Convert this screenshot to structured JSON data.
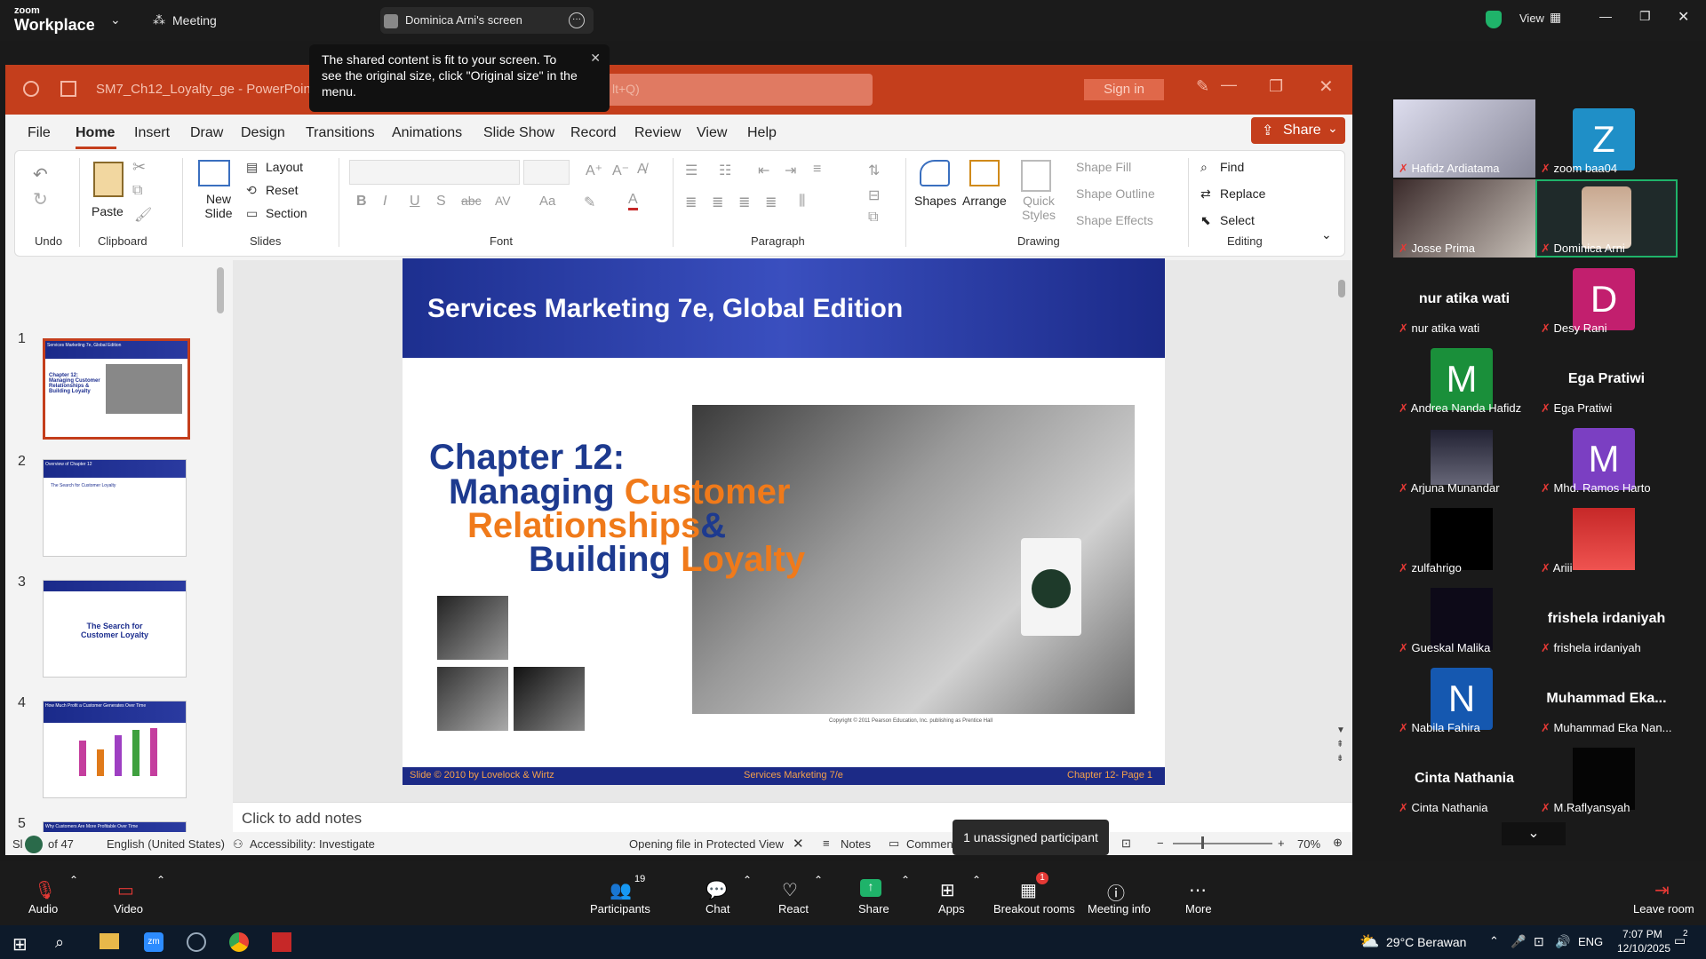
{
  "zoom": {
    "logo_top": "zoom",
    "logo_bottom": "Workplace",
    "meeting_label": "Meeting",
    "screen_tab": "Dominica Arni's screen",
    "view_label": "View",
    "tooltip": "The shared content is fit to your screen. To see the original size, click \"Original size\" in the menu.",
    "unassigned": "1 unassigned participant",
    "controls": {
      "audio": "Audio",
      "video": "Video",
      "participants": "Participants",
      "participants_count": "19",
      "chat": "Chat",
      "react": "React",
      "share": "Share",
      "apps": "Apps",
      "breakout": "Breakout rooms",
      "breakout_badge": "1",
      "info": "Meeting info",
      "more": "More",
      "leave": "Leave room"
    }
  },
  "ppt": {
    "title": "SM7_Ch12_Loyalty_ge - PowerPoint",
    "search_hint": "lt+Q)",
    "signin": "Sign in",
    "share": "Share",
    "menu": [
      "File",
      "Home",
      "Insert",
      "Draw",
      "Design",
      "Transitions",
      "Animations",
      "Slide Show",
      "Record",
      "Review",
      "View",
      "Help"
    ],
    "ribbon": {
      "undo": "Undo",
      "paste": "Paste",
      "clipboard": "Clipboard",
      "new_slide": "New Slide",
      "layout": "Layout",
      "reset": "Reset",
      "section": "Section",
      "slides": "Slides",
      "font": "Font",
      "paragraph": "Paragraph",
      "shapes": "Shapes",
      "arrange": "Arrange",
      "quick_styles": "Quick Styles",
      "shape_fill": "Shape Fill",
      "shape_outline": "Shape Outline",
      "shape_effects": "Shape Effects",
      "drawing": "Drawing",
      "find": "Find",
      "replace": "Replace",
      "select": "Select",
      "editing": "Editing"
    },
    "thumbnails": [
      {
        "num": "1",
        "title": "Services Marketing 7e, Global Edition",
        "body": "Chapter 12: Managing Customer Relationships & Building Loyalty"
      },
      {
        "num": "2",
        "title": "Overview of Chapter 12",
        "body": "The Search for Customer Loyalty"
      },
      {
        "num": "3",
        "title": "",
        "body": "The Search for Customer Loyalty"
      },
      {
        "num": "4",
        "title": "How Much Profit a Customer Generates Over Time",
        "body": ""
      },
      {
        "num": "5",
        "title": "Why Customers Are More Profitable Over Time",
        "body": ""
      }
    ],
    "slide": {
      "header": "Services Marketing 7e, Global Edition",
      "chapter": "Chapter 12:",
      "line2a": "Managing ",
      "line2b": "Customer",
      "line3a": "Relationships",
      "line3b": "&",
      "line4a": "Building ",
      "line4b": "Loyalty",
      "copyright": "Copyright © 2011 Pearson Education, Inc. publishing as Prentice Hall",
      "footer_left": "Slide © 2010 by Lovelock & Wirtz",
      "footer_center": "Services Marketing 7/e",
      "footer_right": "Chapter 12- Page 1"
    },
    "notes": "Click to add notes",
    "status": {
      "slide_of": "Sl",
      "slide_of2": "of 47",
      "language": "English (United States)",
      "accessibility": "Accessibility: Investigate",
      "protected": "Opening file in Protected View",
      "notes_btn": "Notes",
      "comments_btn": "Comment",
      "zoom": "70%"
    }
  },
  "participants": [
    {
      "name": "Hafidz Ardiatama",
      "type": "video"
    },
    {
      "name": "zoom baa04",
      "type": "letter",
      "letter": "Z",
      "color": "#1f8fc7"
    },
    {
      "name": "Josse Prima",
      "type": "video"
    },
    {
      "name": "Dominica Arni",
      "type": "video"
    },
    {
      "name": "nur atika wati",
      "type": "text"
    },
    {
      "name": "Desy Rani",
      "type": "letter",
      "letter": "D",
      "color": "#c21f6e"
    },
    {
      "name": "Andrea Nanda Hafidz",
      "type": "letter",
      "letter": "M",
      "color": "#1a8f3a"
    },
    {
      "name": "Ega Pratiwi",
      "type": "text"
    },
    {
      "name": "Arjuna Munandar",
      "type": "video"
    },
    {
      "name": "Mhd. Ramos Harto",
      "type": "letter",
      "letter": "M",
      "color": "#7b3fc2"
    },
    {
      "name": "zulfahrigo",
      "type": "video"
    },
    {
      "name": "Ariii",
      "type": "video"
    },
    {
      "name": "Gueskal Malika",
      "type": "video"
    },
    {
      "name": "frishela irdaniyah",
      "type": "text"
    },
    {
      "name": "Nabila Fahira",
      "type": "letter",
      "letter": "N",
      "color": "#1558b0"
    },
    {
      "name": "Muhammad Eka Nan...",
      "type": "text",
      "big": "Muhammad  Eka..."
    },
    {
      "name": "Cinta Nathania",
      "type": "text"
    },
    {
      "name": "M.Raflyansyah",
      "type": "video"
    }
  ],
  "taskbar": {
    "weather": "29°C  Berawan",
    "lang": "ENG",
    "time": "7:07 PM",
    "date": "12/10/2025",
    "notif": "2"
  },
  "colors": {
    "ppt_red": "#c43e1c",
    "slide_blue": "#1d2f8f",
    "slide_orange": "#f07a1a",
    "zoom_green": "#1fb36a"
  }
}
